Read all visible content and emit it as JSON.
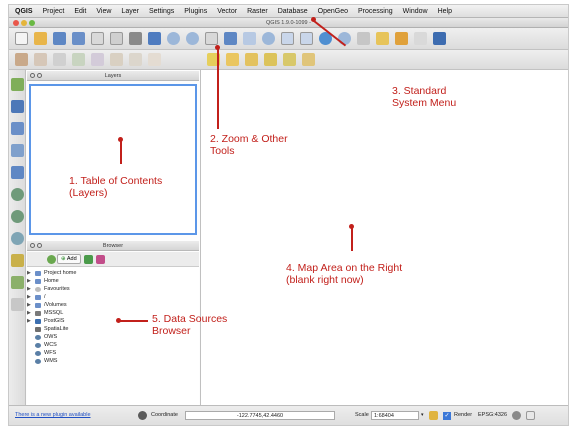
{
  "menu": {
    "app": "QGIS",
    "items": [
      "Project",
      "Edit",
      "View",
      "Layer",
      "Settings",
      "Plugins",
      "Vector",
      "Raster",
      "Database",
      "OpenGeo",
      "Processing",
      "Window",
      "Help"
    ]
  },
  "window": {
    "title": "QGIS 1.9.0-1099 - "
  },
  "layers_panel": {
    "title": "Layers"
  },
  "browser_panel": {
    "title": "Browser",
    "add_label": "Add",
    "items": [
      {
        "label": "Project home",
        "expandable": true,
        "icon": "folder"
      },
      {
        "label": "Home",
        "expandable": true,
        "icon": "folder"
      },
      {
        "label": "Favourites",
        "expandable": true,
        "icon": "star"
      },
      {
        "label": "/",
        "expandable": true,
        "icon": "folder"
      },
      {
        "label": "/Volumes",
        "expandable": true,
        "icon": "folder"
      },
      {
        "label": "MSSQL",
        "expandable": true,
        "icon": "database"
      },
      {
        "label": "PostGIS",
        "expandable": true,
        "icon": "elephant"
      },
      {
        "label": "SpatiaLite",
        "expandable": false,
        "icon": "feather"
      },
      {
        "label": "OWS",
        "expandable": false,
        "icon": "globe"
      },
      {
        "label": "WCS",
        "expandable": false,
        "icon": "globe"
      },
      {
        "label": "WFS",
        "expandable": false,
        "icon": "globe"
      },
      {
        "label": "WMS",
        "expandable": false,
        "icon": "globe"
      }
    ]
  },
  "status_bar": {
    "plugin_notice": "There is a new plugin available",
    "coordinate_label": "Coordinate",
    "coordinate_value": "-122.7745,42.4460",
    "scale_label": "Scale",
    "scale_value": "1:68404",
    "render_label": "Render",
    "crs": "EPSG:4326"
  },
  "annotations": {
    "toc": [
      "1. Table of Contents",
      "(Layers)"
    ],
    "zoom": [
      "2. Zoom & Other",
      "Tools"
    ],
    "menu": [
      "3. Standard",
      "System Menu"
    ],
    "map": [
      "4. Map Area on the Right",
      "(blank right now)"
    ],
    "browser": [
      "5. Data Sources",
      "Browser"
    ]
  },
  "colors": {
    "annotation": "#c2201b",
    "layers_border": "#5b96e8"
  }
}
